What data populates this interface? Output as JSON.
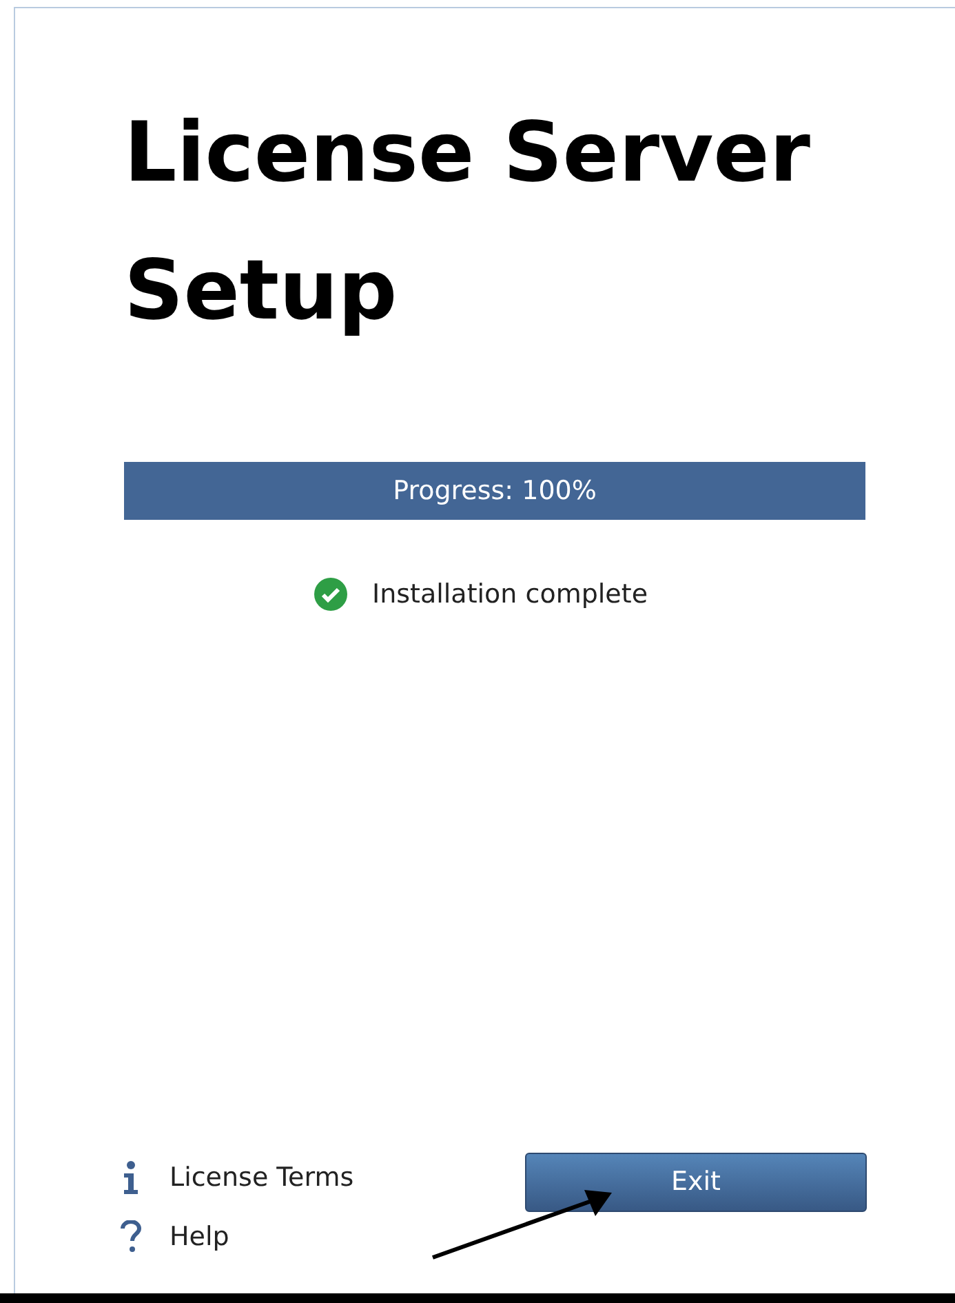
{
  "title": "License Server Setup",
  "progress": {
    "label": "Progress: 100%",
    "level": 1
  },
  "status": {
    "text": "Installation complete"
  },
  "links": [
    {
      "kind": "info",
      "label": "License Terms"
    },
    {
      "kind": "help",
      "label": "Help"
    }
  ],
  "buttons": [
    "Exit"
  ]
}
